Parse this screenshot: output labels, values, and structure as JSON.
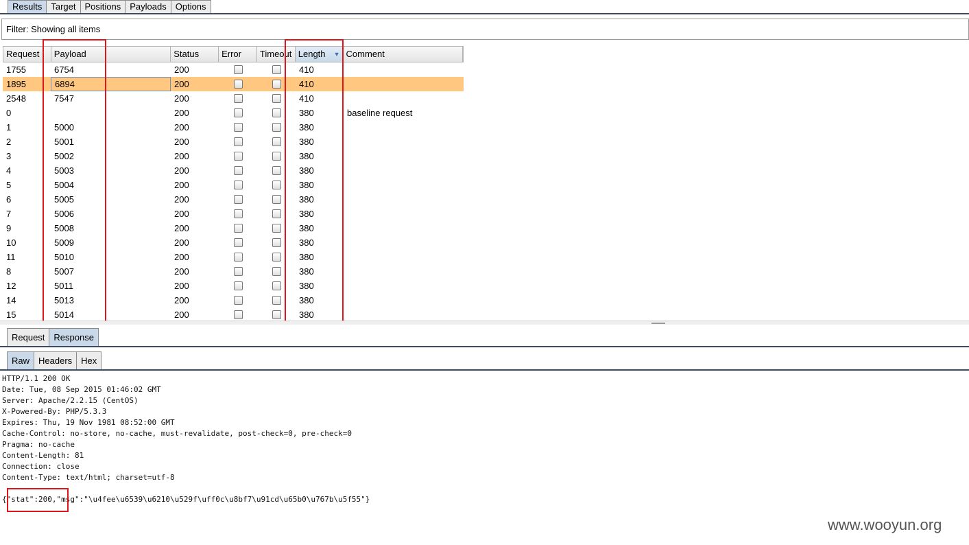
{
  "top_tabs": [
    "Results",
    "Target",
    "Positions",
    "Payloads",
    "Options"
  ],
  "filter": {
    "text": "Filter: Showing all items"
  },
  "table": {
    "headers": [
      "Request",
      "Payload",
      "Status",
      "Error",
      "Timeout",
      "Length",
      "Comment"
    ],
    "sorted_column": "Length",
    "selected_row_index": 1,
    "rows": [
      {
        "request": "1755",
        "payload": "6754",
        "status": "200",
        "error": false,
        "timeout": false,
        "length": "410",
        "comment": ""
      },
      {
        "request": "1895",
        "payload": "6894",
        "status": "200",
        "error": false,
        "timeout": false,
        "length": "410",
        "comment": ""
      },
      {
        "request": "2548",
        "payload": "7547",
        "status": "200",
        "error": false,
        "timeout": false,
        "length": "410",
        "comment": ""
      },
      {
        "request": "0",
        "payload": "",
        "status": "200",
        "error": false,
        "timeout": false,
        "length": "380",
        "comment": "baseline request"
      },
      {
        "request": "1",
        "payload": "5000",
        "status": "200",
        "error": false,
        "timeout": false,
        "length": "380",
        "comment": ""
      },
      {
        "request": "2",
        "payload": "5001",
        "status": "200",
        "error": false,
        "timeout": false,
        "length": "380",
        "comment": ""
      },
      {
        "request": "3",
        "payload": "5002",
        "status": "200",
        "error": false,
        "timeout": false,
        "length": "380",
        "comment": ""
      },
      {
        "request": "4",
        "payload": "5003",
        "status": "200",
        "error": false,
        "timeout": false,
        "length": "380",
        "comment": ""
      },
      {
        "request": "5",
        "payload": "5004",
        "status": "200",
        "error": false,
        "timeout": false,
        "length": "380",
        "comment": ""
      },
      {
        "request": "6",
        "payload": "5005",
        "status": "200",
        "error": false,
        "timeout": false,
        "length": "380",
        "comment": ""
      },
      {
        "request": "7",
        "payload": "5006",
        "status": "200",
        "error": false,
        "timeout": false,
        "length": "380",
        "comment": ""
      },
      {
        "request": "9",
        "payload": "5008",
        "status": "200",
        "error": false,
        "timeout": false,
        "length": "380",
        "comment": ""
      },
      {
        "request": "10",
        "payload": "5009",
        "status": "200",
        "error": false,
        "timeout": false,
        "length": "380",
        "comment": ""
      },
      {
        "request": "11",
        "payload": "5010",
        "status": "200",
        "error": false,
        "timeout": false,
        "length": "380",
        "comment": ""
      },
      {
        "request": "8",
        "payload": "5007",
        "status": "200",
        "error": false,
        "timeout": false,
        "length": "380",
        "comment": ""
      },
      {
        "request": "12",
        "payload": "5011",
        "status": "200",
        "error": false,
        "timeout": false,
        "length": "380",
        "comment": ""
      },
      {
        "request": "14",
        "payload": "5013",
        "status": "200",
        "error": false,
        "timeout": false,
        "length": "380",
        "comment": ""
      },
      {
        "request": "15",
        "payload": "5014",
        "status": "200",
        "error": false,
        "timeout": false,
        "length": "380",
        "comment": ""
      }
    ]
  },
  "message_tabs": [
    "Request",
    "Response"
  ],
  "view_tabs": [
    "Raw",
    "Headers",
    "Hex"
  ],
  "response_lines": [
    "HTTP/1.1 200 OK",
    "Date: Tue, 08 Sep 2015 01:46:02 GMT",
    "Server: Apache/2.2.15 (CentOS)",
    "X-Powered-By: PHP/5.3.3",
    "Expires: Thu, 19 Nov 1981 08:52:00 GMT",
    "Cache-Control: no-store, no-cache, must-revalidate, post-check=0, pre-check=0",
    "Pragma: no-cache",
    "Content-Length: 81",
    "Connection: close",
    "Content-Type: text/html; charset=utf-8",
    "",
    "{\"stat\":200,\"msg\":\"\\u4fee\\u6539\\u6210\\u529f\\uff0c\\u8bf7\\u91cd\\u65b0\\u767b\\u5f55\"}"
  ],
  "watermark": "www.wooyun.org",
  "colors": {
    "selected_row": "#ffc77f",
    "highlight_box": "#e0151a",
    "selected_tab": "#c9d9ea"
  }
}
